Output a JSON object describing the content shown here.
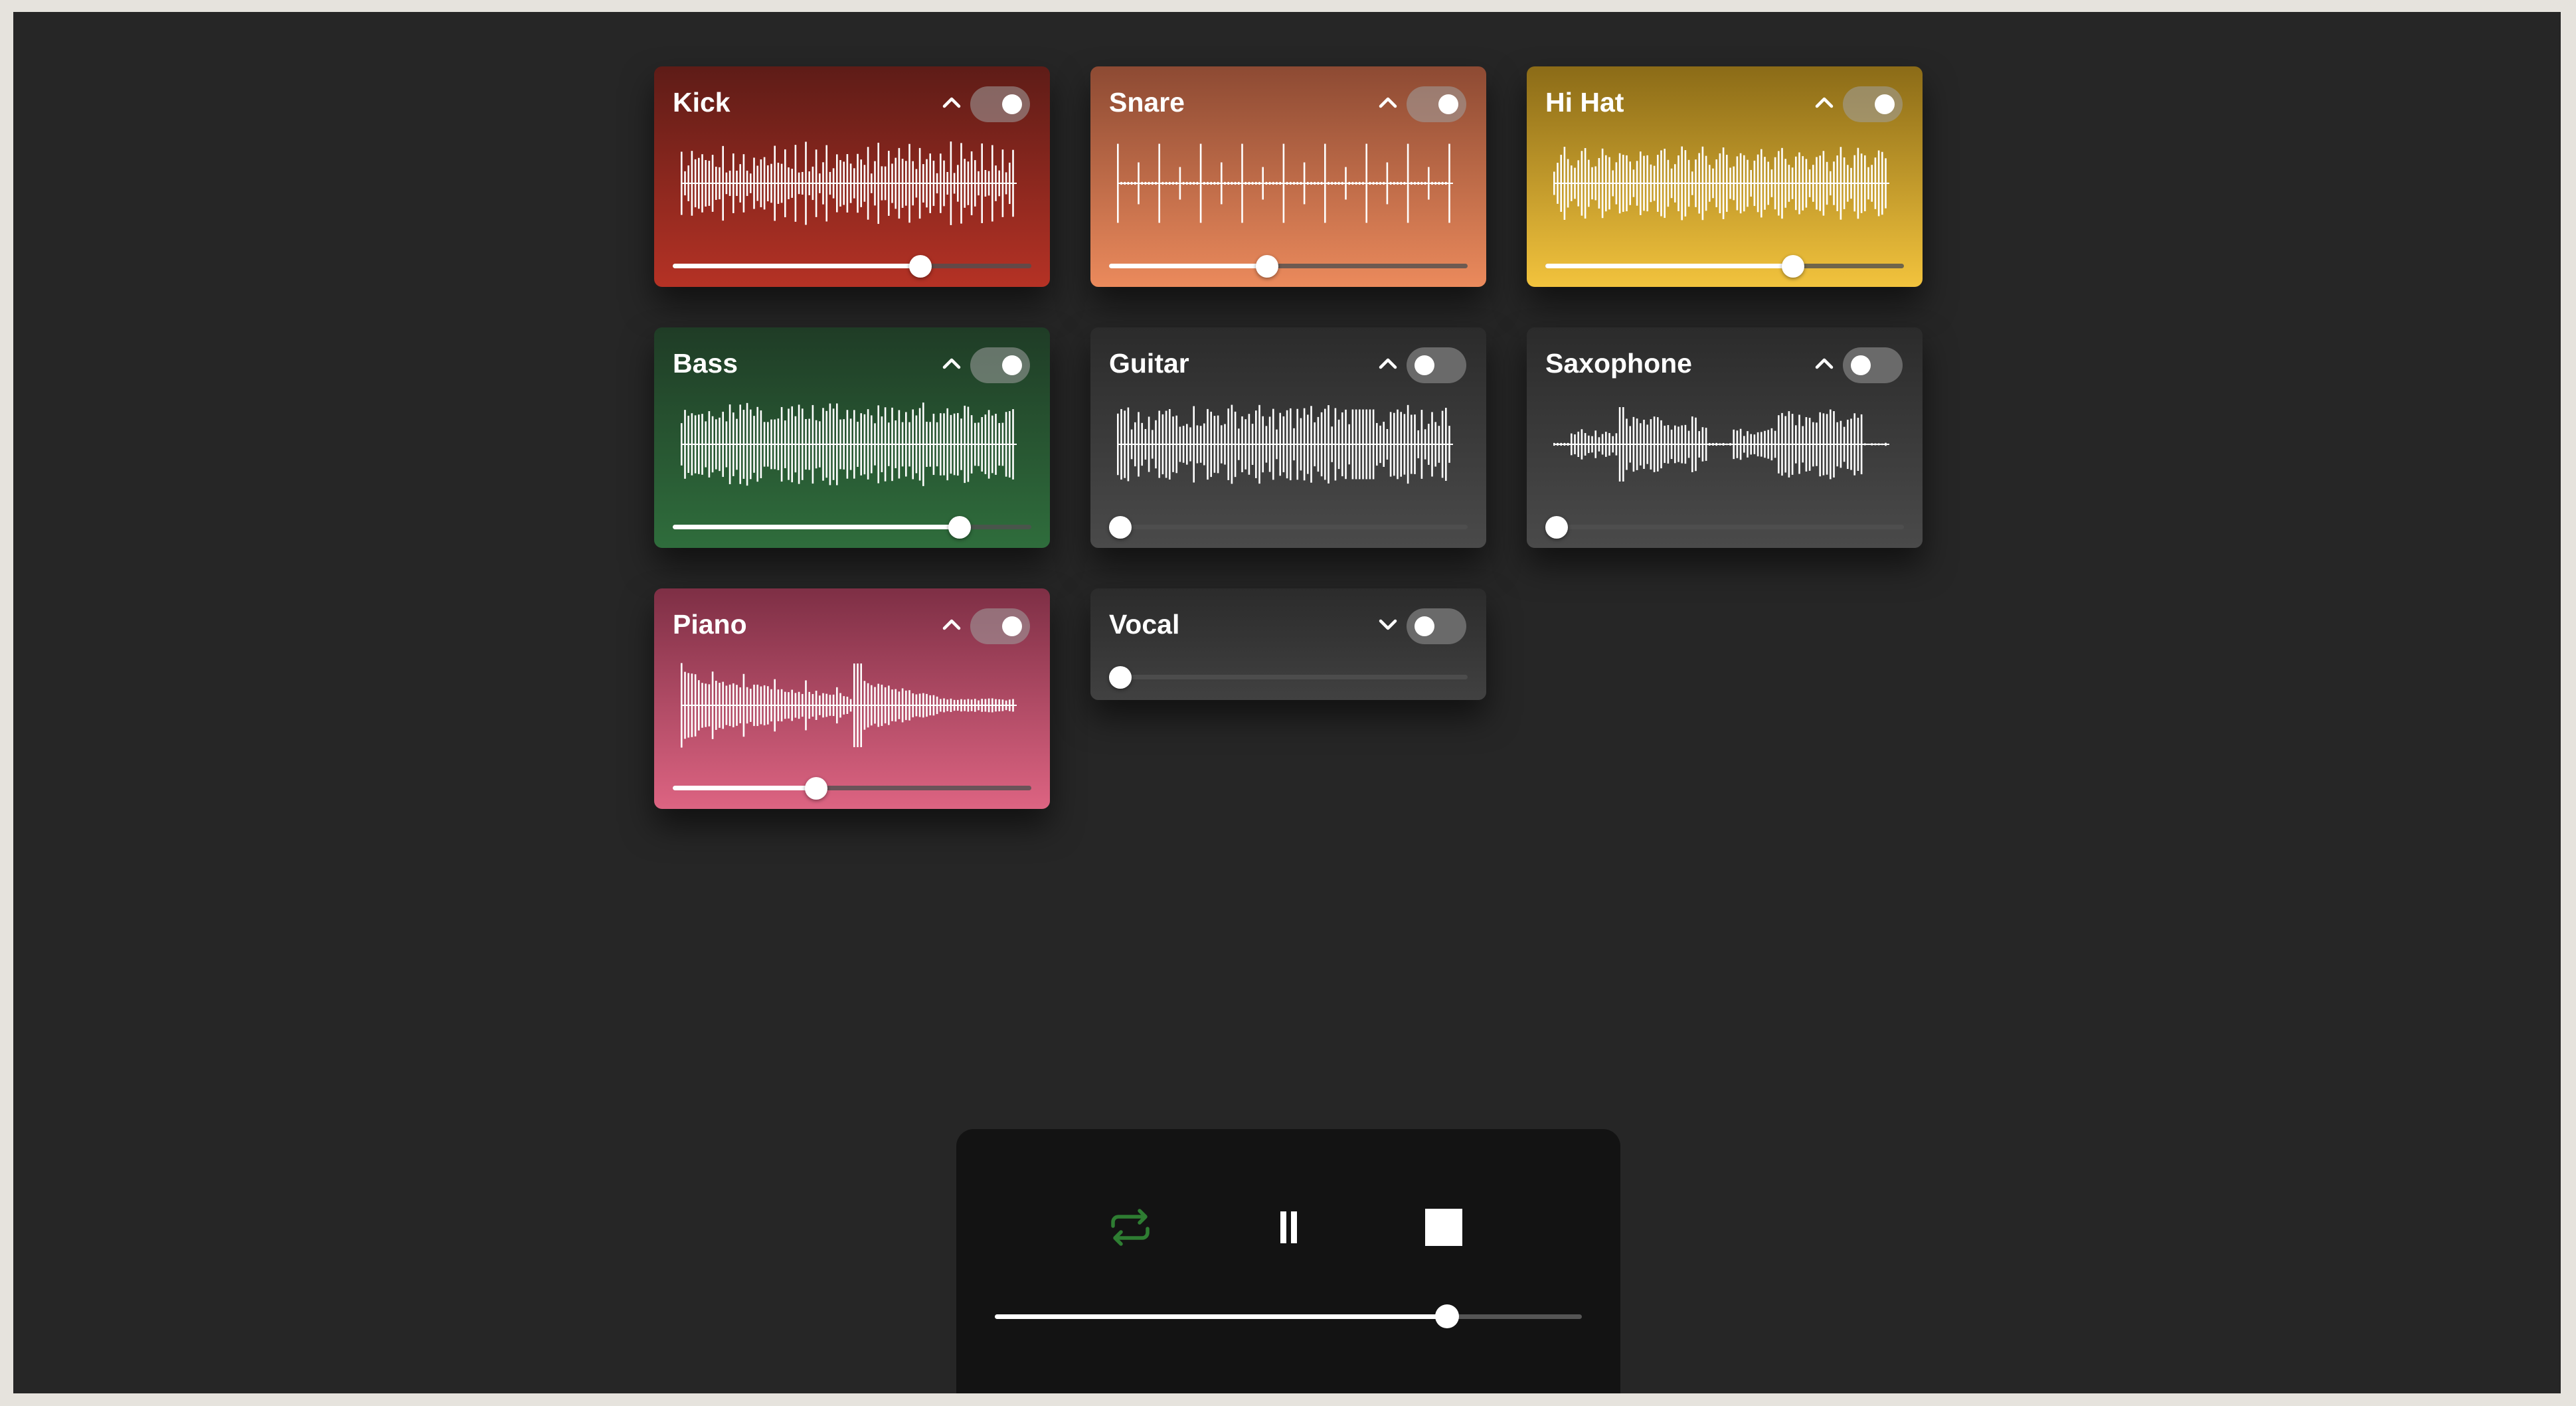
{
  "tracks": [
    {
      "name": "Kick",
      "enabled": true,
      "expanded": true,
      "volume": 0.69,
      "color_top": "#5e1c17",
      "color_bottom": "#b53225",
      "wave": "kick"
    },
    {
      "name": "Snare",
      "enabled": true,
      "expanded": true,
      "volume": 0.44,
      "color_top": "#8d4a33",
      "color_bottom": "#eb8a5c",
      "wave": "snare"
    },
    {
      "name": "Hi Hat",
      "enabled": true,
      "expanded": true,
      "volume": 0.69,
      "color_top": "#8b6b17",
      "color_bottom": "#f2c33d",
      "wave": "hihat"
    },
    {
      "name": "Bass",
      "enabled": true,
      "expanded": true,
      "volume": 0.8,
      "color_top": "#1f3c26",
      "color_bottom": "#2f6d3c",
      "wave": "bass"
    },
    {
      "name": "Guitar",
      "enabled": false,
      "expanded": true,
      "volume": 0.0,
      "color_top": "#2b2b2b",
      "color_bottom": "#4a4a4a",
      "wave": "guitar"
    },
    {
      "name": "Saxophone",
      "enabled": false,
      "expanded": true,
      "volume": 0.0,
      "color_top": "#2b2b2b",
      "color_bottom": "#4a4a4a",
      "wave": "sax"
    },
    {
      "name": "Piano",
      "enabled": true,
      "expanded": true,
      "volume": 0.4,
      "color_top": "#7e2f45",
      "color_bottom": "#dd6482",
      "wave": "piano"
    },
    {
      "name": "Vocal",
      "enabled": false,
      "expanded": false,
      "volume": 0.0,
      "color_top": "#2b2b2b",
      "color_bottom": "#414141",
      "wave": "vocal"
    }
  ],
  "transport": {
    "loop_icon": "repeat-icon",
    "loop_active_color": "#2e7d32",
    "pause_icon": "pause-icon",
    "stop_icon": "stop-icon",
    "progress": 0.77
  }
}
